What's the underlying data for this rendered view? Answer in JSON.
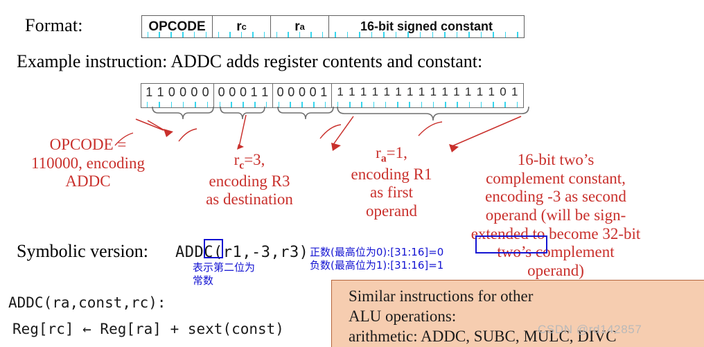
{
  "slide": {
    "format_label": "Format:",
    "example_line": "Example instruction: ADDC adds register contents and constant:",
    "symbolic_label": "Symbolic version:",
    "symbolic_code": "ADDC(r1,-3,r3)",
    "code_signature": "ADDC(ra,const,rc):",
    "code_body": "Reg[rc] ← Reg[ra] + sext(const)"
  },
  "format_fields": [
    {
      "name": "opcode",
      "label": "OPCODE",
      "sub": ""
    },
    {
      "name": "rc",
      "label": "r",
      "sub": "c"
    },
    {
      "name": "ra",
      "label": "r",
      "sub": "a"
    },
    {
      "name": "constant",
      "label": "16-bit signed constant",
      "sub": ""
    }
  ],
  "bit_fields": [
    {
      "name": "opcode-bits",
      "bits": "110000"
    },
    {
      "name": "rc-bits",
      "bits": "00011"
    },
    {
      "name": "ra-bits",
      "bits": "00001"
    },
    {
      "name": "constant-bits",
      "bits": "1111111111111101"
    }
  ],
  "annotations": {
    "opcode": "OPCODE = 110000, encoding ADDC",
    "rc": "r_c=3, encoding R3 as destination",
    "ra": "r_a=1, encoding R1 as first operand",
    "constant": "16-bit two’s complement constant, encoding -3 as second operand (will be sign-extended to become 32-bit two’s complement operand)",
    "opcode_lines": [
      "OPCODE =",
      "110000, encoding",
      "ADDC"
    ],
    "rc_lines": [
      "=3,",
      "encoding R3",
      "as destination"
    ],
    "rc_prefix": "r",
    "rc_sub": "c",
    "ra_lines": [
      "=1,",
      "encoding R1",
      "as first",
      "operand"
    ],
    "ra_prefix": "r",
    "ra_sub": "a",
    "const_lines": [
      "16-bit two’s",
      "complement constant,",
      "encoding -3 as second",
      "operand (will be sign-",
      "extended to become 32-bit",
      "two’s complement",
      "operand)"
    ]
  },
  "cjk_notes": {
    "left": [
      "表示第二位为",
      "常数"
    ],
    "right": [
      "正数(最高位为0):[31:16]=0",
      "负数(最高位为1):[31:16]=1"
    ]
  },
  "similar_box": {
    "lines": [
      "Similar instructions for other",
      "ALU operations:",
      "arithmetic: ADDC, SUBC, MULC, DIVC"
    ]
  },
  "watermark": "CSDN @rd142857",
  "colors": {
    "annotation_red": "#c9302c",
    "note_blue": "#1414d2",
    "box_peach": "#f6cdb0",
    "box_peach_border": "#b5653b",
    "tick_cyan": "#35d6ee",
    "watermark_gray": "#b9b9b9"
  }
}
